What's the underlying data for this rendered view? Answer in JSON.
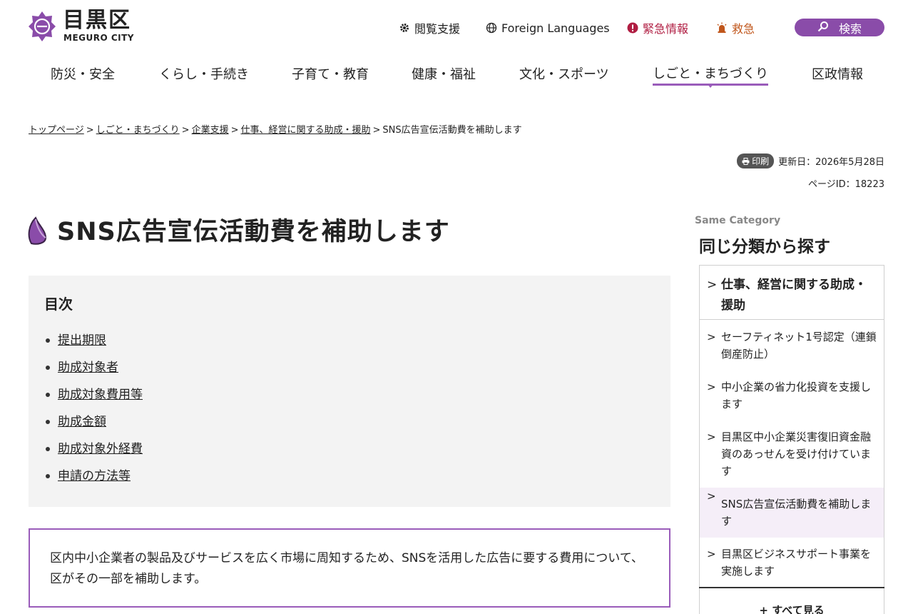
{
  "header": {
    "logo_jp": "目黒区",
    "logo_en": "MEGURO CITY",
    "utility": {
      "accessibility": "閲覧支援",
      "foreign": "Foreign Languages",
      "emergency": "緊急情報",
      "kyukyu": "救急",
      "search": "検索"
    }
  },
  "gnav": {
    "items": [
      {
        "label": "防災・安全"
      },
      {
        "label": "くらし・手続き"
      },
      {
        "label": "子育て・教育"
      },
      {
        "label": "健康・福祉"
      },
      {
        "label": "文化・スポーツ"
      },
      {
        "label": "しごと・まちづくり"
      },
      {
        "label": "区政情報"
      }
    ],
    "active_index": 5
  },
  "breadcrumb": {
    "items": [
      "トップページ",
      "しごと・まちづくり",
      "企業支援",
      "仕事、経営に関する助成・援助"
    ],
    "current": "SNS広告宣伝活動費を補助します",
    "separator": ">"
  },
  "meta": {
    "print": "印刷",
    "updated": "更新日：2026年5月28日",
    "page_id": "ページID：18223"
  },
  "page_title": "SNS広告宣伝活動費を補助します",
  "toc": {
    "title": "目次",
    "items": [
      "提出期限",
      "助成対象者",
      "助成対象費用等",
      "助成金額",
      "助成対象外経費",
      "申請の方法等"
    ]
  },
  "intro": "区内中小企業者の製品及びサービスを広く市場に周知するため、SNSを活用した広告に要する費用について、区がその一部を補助します。",
  "sidebar": {
    "subtitle": "Same Category",
    "title": "同じ分類から探す",
    "heading": "仕事、経営に関する助成・援助",
    "items": [
      {
        "label": "セーフティネット1号認定（連鎖倒産防止）"
      },
      {
        "label": "中小企業の省力化投資を支援します"
      },
      {
        "label": "目黒区中小企業災害復旧資金融資のあっせんを受け付けています"
      },
      {
        "label": "SNS広告宣伝活動費を補助します",
        "current": true
      },
      {
        "label": "目黒区ビジネスサポート事業を実施します"
      }
    ],
    "more": "+ すべて見る"
  },
  "colors": {
    "brand": "#8a4ca9",
    "emergency": "#b01d42",
    "kyukyu": "#c0561b"
  }
}
